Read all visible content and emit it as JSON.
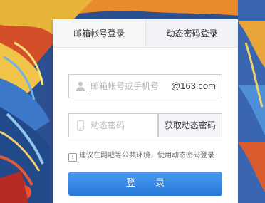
{
  "login": {
    "tabs": [
      {
        "label": "邮箱帐号登录"
      },
      {
        "label": "动态密码登录"
      }
    ],
    "account_placeholder": "邮箱帐号或手机号",
    "domain_suffix": "@163.com",
    "code_placeholder": "动态密码",
    "get_code_label": "获取动态密码",
    "notice_text": "建议在网吧等公共环境，使用动态密码登录",
    "notice_icon_glyph": "!",
    "submit_label": "登 录"
  },
  "colors": {
    "primary_button": "#2f86e6",
    "field_border": "#c9cdd4"
  }
}
